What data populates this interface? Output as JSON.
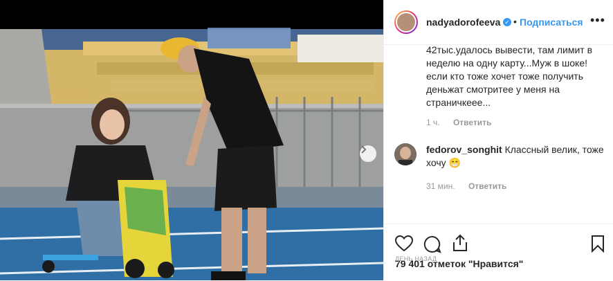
{
  "header": {
    "username": "nadyadorofeeva",
    "separator": "•",
    "follow_label": "Подписаться",
    "more_label": "•••"
  },
  "caption": {
    "text": "42тыс.удалось вывести, там лимит в неделю на одну карту...Муж в шоке! если кто тоже хочет тоже получить деньжат смотритее у меня на страничкеее...",
    "time": "1 ч.",
    "reply_label": "Ответить"
  },
  "comment": {
    "username": "fedorov_songhit",
    "text": "Классный велик, тоже хочу 😁",
    "time": "31 мин.",
    "reply_label": "Ответить"
  },
  "footer": {
    "likes": "79 401 отметок \"Нравится\"",
    "timestamp": "ДЕНЬ НАЗАД"
  },
  "colors": {
    "link": "#3897f0",
    "text": "#262626",
    "muted": "#999999"
  },
  "icons": {
    "heart": "heart-icon",
    "comment": "comment-icon",
    "share": "share-icon",
    "bookmark": "bookmark-icon",
    "next": "chevron-right-icon"
  }
}
